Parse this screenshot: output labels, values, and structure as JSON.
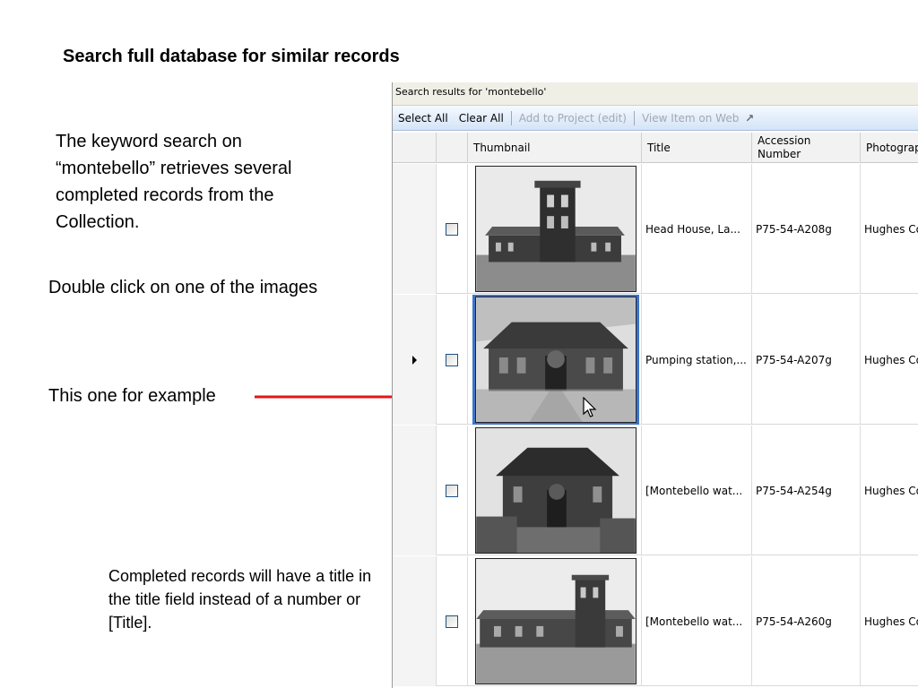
{
  "slide": {
    "title": "Search full database for similar records",
    "note_keyword": "The keyword search on “montebello” retrieves several completed records from the Collection.",
    "note_double_click": "Double click on one of the images",
    "note_example": "This one for example",
    "note_completed": "Completed records will have a title in the title field instead of a number or [Title]."
  },
  "app": {
    "header": "Search results for 'montebello'",
    "toolbar": {
      "select_all": "Select All",
      "clear_all": "Clear All",
      "add_to_project": "Add to Project (edit)",
      "view_item_on_web": "View Item on Web"
    },
    "columns": {
      "thumbnail": "Thumbnail",
      "title": "Title",
      "accession": "Accession Number",
      "photographer": "Photographer"
    },
    "rows": [
      {
        "title": "Head House, La...",
        "accession": "P75-54-A208g",
        "photographer": "Hughes Co"
      },
      {
        "title": "Pumping station,...",
        "accession": "P75-54-A207g",
        "photographer": "Hughes Co"
      },
      {
        "title": "[Montebello wat...",
        "accession": "P75-54-A254g",
        "photographer": "Hughes Co"
      },
      {
        "title": "[Montebello wat...",
        "accession": "P75-54-A260g",
        "photographer": "Hughes Co"
      }
    ]
  },
  "colors": {
    "arrow": "#e3161a",
    "selection": "#3c74c9"
  },
  "icons": {
    "external_link": "arrow-up-right-icon",
    "row_pointer": "triangle-right-icon",
    "cursor": "mouse-pointer-icon"
  }
}
